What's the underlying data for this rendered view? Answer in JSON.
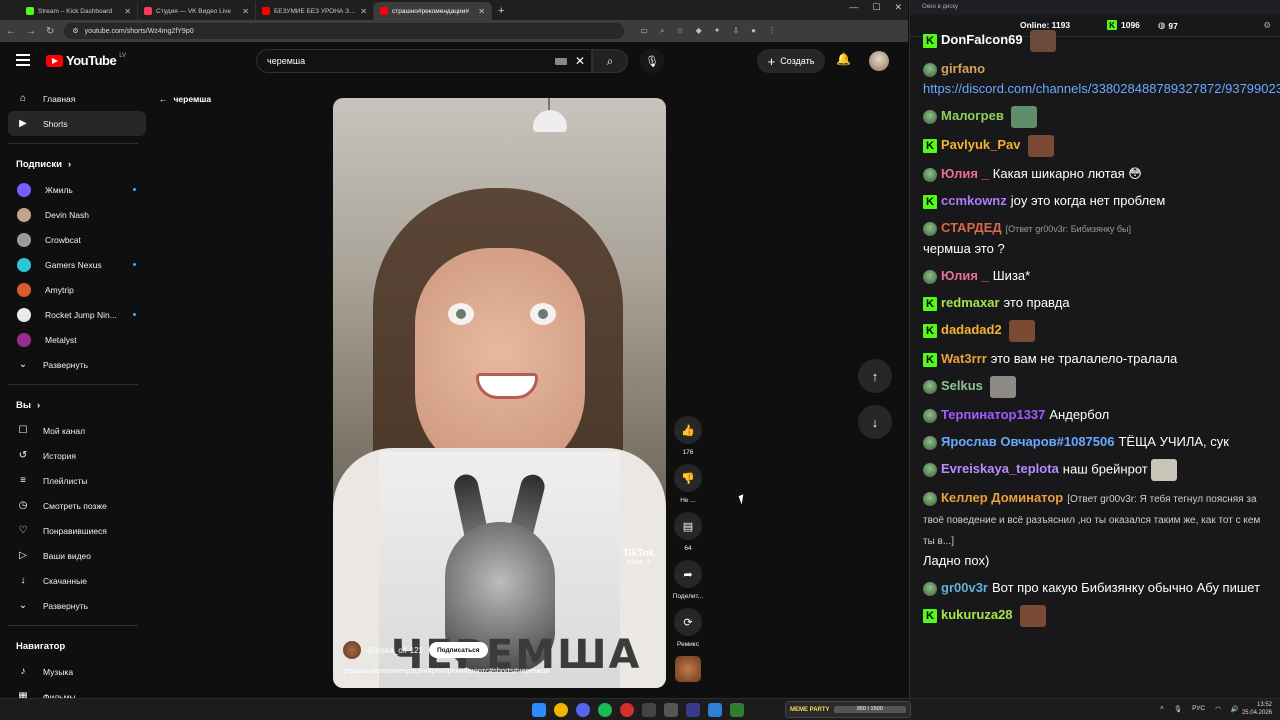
{
  "browser": {
    "tabs": [
      {
        "label": "Stream – Kick Dashboard",
        "color": "#53fc18",
        "active": false
      },
      {
        "label": "Студия — VK Видео Live",
        "color": "#ff3b5c",
        "active": false
      },
      {
        "label": "БЕЗУМИЕ БЕЗ УРОНА ЗА 4 ЧА",
        "color": "#ff0000",
        "active": false
      },
      {
        "label": "страшно#рекомендации#",
        "color": "#ff0000",
        "active": true
      }
    ],
    "url": "youtube.com/shorts/Wz4mg2fY9p0"
  },
  "youtube": {
    "logo_text": "YouTube",
    "logo_region": "LV",
    "search_value": "черемша",
    "create_label": "Создать",
    "sidebar": {
      "main": [
        {
          "label": "Главная",
          "icon": "home-icon",
          "glyph": "⌂",
          "active": false
        },
        {
          "label": "Shorts",
          "icon": "shorts-icon",
          "glyph": "▶",
          "active": true
        }
      ],
      "subs_header": "Подписки",
      "subs": [
        {
          "label": "Жмиль",
          "color": "#7a5cff",
          "dot": true
        },
        {
          "label": "Devin Nash",
          "color": "#c4a58a",
          "dot": false
        },
        {
          "label": "Crowbcat",
          "color": "#9a9a9a",
          "dot": false
        },
        {
          "label": "Gamers Nexus",
          "color": "#2bc7d7",
          "dot": true
        },
        {
          "label": "Amytrip",
          "color": "#d85c2a",
          "dot": false
        },
        {
          "label": "Rocket Jump Nin...",
          "color": "#eaeaea",
          "dot": true
        },
        {
          "label": "Metalyst",
          "color": "#9b2c8f",
          "dot": false
        }
      ],
      "subs_expand": "Развернуть",
      "you_header": "Вы",
      "you": [
        {
          "label": "Мой канал",
          "icon": "channel-icon",
          "glyph": "☐"
        },
        {
          "label": "История",
          "icon": "history-icon",
          "glyph": "↺"
        },
        {
          "label": "Плейлисты",
          "icon": "playlists-icon",
          "glyph": "≡"
        },
        {
          "label": "Смотреть позже",
          "icon": "watch-later-icon",
          "glyph": "◷"
        },
        {
          "label": "Понравившиеся",
          "icon": "liked-icon",
          "glyph": "♡"
        },
        {
          "label": "Ваши видео",
          "icon": "your-videos-icon",
          "glyph": "▷"
        },
        {
          "label": "Скачанные",
          "icon": "downloads-icon",
          "glyph": "↓"
        }
      ],
      "you_expand": "Развернуть",
      "nav_header": "Навигатор",
      "nav": [
        {
          "label": "Музыка",
          "icon": "music-icon",
          "glyph": "♪"
        },
        {
          "label": "Фильмы",
          "icon": "movies-icon",
          "glyph": "▦"
        }
      ]
    },
    "back_label": "черемша",
    "video": {
      "channel": "@iriska_off-121",
      "subscribe": "Подписаться",
      "title": "страшно#рекомендации#рек#реки#шортс#shorts#черемша",
      "overlay_text": "ЧЕРЕМША",
      "tiktok": "TikTok",
      "tiktok_user": "ichka_fi"
    },
    "actions": {
      "likes": "176",
      "dislike": "Не ...",
      "comments": "64",
      "share": "Поделит...",
      "remix": "Ремикс"
    }
  },
  "chat": {
    "window_title": "Окно в диску",
    "online_label": "Online:",
    "online_count": "1193",
    "kick_count": "1096",
    "twitch_count": "97",
    "messages": [
      {
        "badge": "kick",
        "name": "DonFalcon69",
        "color": "#ffffff",
        "reply": "",
        "text": "",
        "emote": "#6b4a3a"
      },
      {
        "badge": "tw",
        "name": "girfano",
        "color": "#d6a253",
        "reply": "",
        "text": "",
        "link": "https://discord.com/channels/338028488789327872/937990232022..."
      },
      {
        "badge": "tw",
        "name": "Малогрев",
        "color": "#8fd15b",
        "reply": "",
        "text": "",
        "emote": "#5f8f6a"
      },
      {
        "badge": "kick",
        "name": "Pavlyuk_Pav",
        "color": "#f3b233",
        "reply": "",
        "text": "",
        "emote": "#7b4a34"
      },
      {
        "badge": "tw",
        "name": "Юлия _",
        "color": "#e86f8f",
        "reply": "",
        "text": "Какая шикарно лютая 😳"
      },
      {
        "badge": "kick",
        "name": "ccmkownz",
        "color": "#b07cff",
        "reply": "",
        "text": "joy это когда нет проблем"
      },
      {
        "badge": "tw",
        "name": "СТАРДЕД",
        "color": "#d9684a",
        "reply": "[Ответ gr00v3r: Бибизянку бы]",
        "text": "чермша это ?"
      },
      {
        "badge": "tw",
        "name": "Юлия _",
        "color": "#e86f8f",
        "reply": "",
        "text": "Шиза*"
      },
      {
        "badge": "kick",
        "name": "redmaxar",
        "color": "#a6e34f",
        "reply": "",
        "text": "это правда"
      },
      {
        "badge": "kick",
        "name": "dadadad2",
        "color": "#f3b233",
        "reply": "",
        "text": "",
        "emote": "#7b4a34"
      },
      {
        "badge": "kick",
        "name": "Wat3rrr",
        "color": "#e8a03d",
        "reply": "",
        "text": "это вам не тралалело-тралала"
      },
      {
        "badge": "tw",
        "name": "Selkus",
        "color": "#8fc28d",
        "reply": "",
        "text": "",
        "emote": "#8d8a86"
      },
      {
        "badge": "tw",
        "name": "Терпинатор1337",
        "color": "#a35cff",
        "reply": "",
        "text": "Андербол"
      },
      {
        "badge": "tw",
        "name": "Ярослав Овчаров#1087506",
        "color": "#69a9ff",
        "reply": "",
        "text": "ТЁЩА УЧИЛА, сук"
      },
      {
        "badge": "tw",
        "name": "Evreiskaya_teplota",
        "color": "#b88cff",
        "reply": "",
        "text": "наш брейнрот",
        "emote": "#c9c4b8"
      },
      {
        "badge": "tw",
        "name": "Келлер Доминатор",
        "color": "#e8a03d",
        "reply": "[Ответ gr00v3r: Я тебя тегнул поясняя за твоё поведение и всё разъяснил ,но ты оказался таким же, как тот с кем ты в...]",
        "text": "Ладно пох)"
      },
      {
        "badge": "tw",
        "name": "gr00v3r",
        "color": "#5fb3d9",
        "reply": "",
        "text": "Вот про какую Бибизянку обычно Абу пишет"
      },
      {
        "badge": "kick",
        "name": "kukuruza28",
        "color": "#a6e34f",
        "reply": "",
        "text": "",
        "emote": "#7b4a34"
      }
    ]
  },
  "taskbar": {
    "widget_name": "MEME PARTY",
    "widget_progress": "950 / 1500",
    "lang": "РУС",
    "time": "13:52",
    "date": "25.04.2026"
  }
}
